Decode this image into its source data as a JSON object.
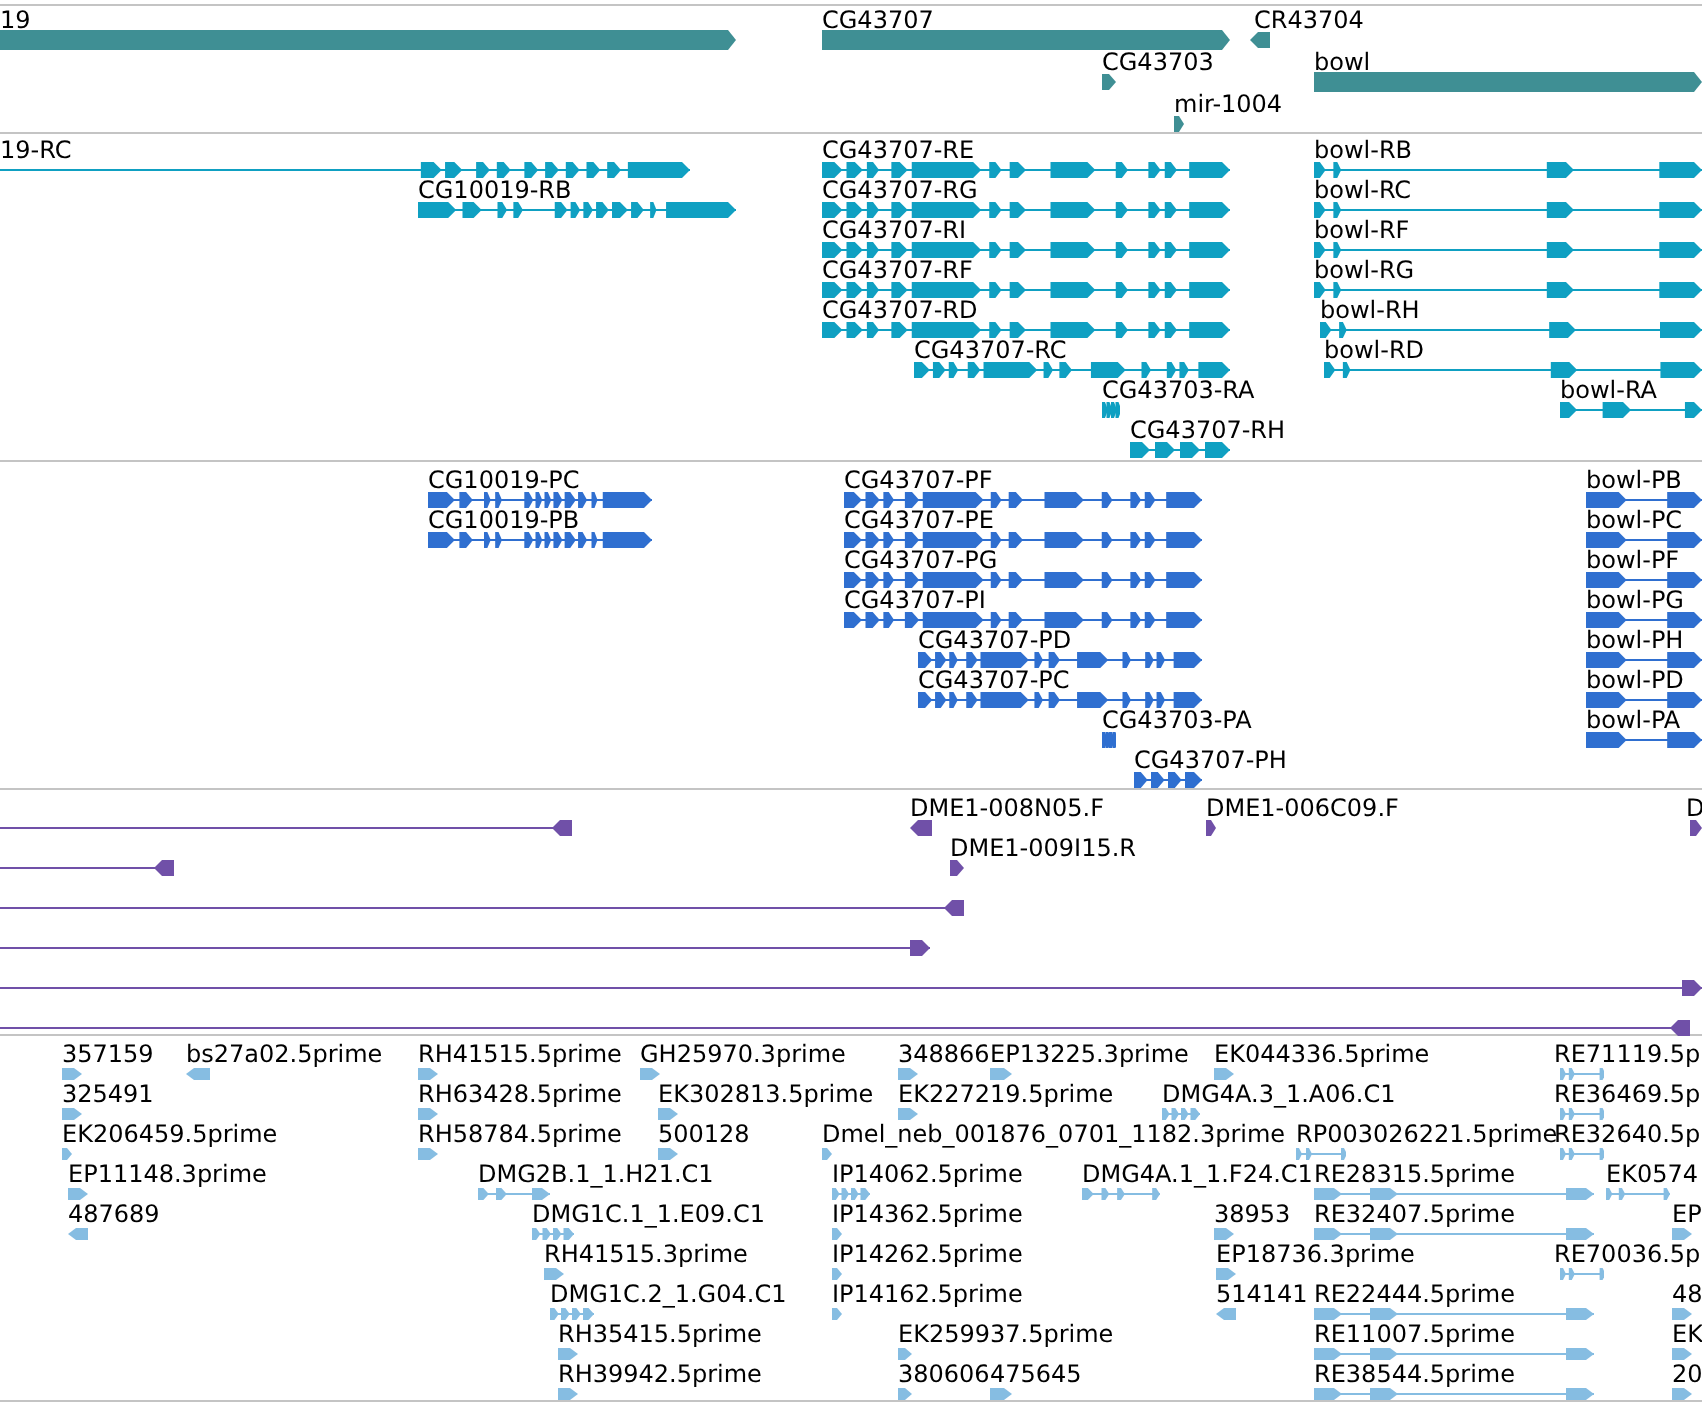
{
  "tracks": [
    {
      "kind": "genes",
      "features": [
        {
          "label": "19",
          "reverse": false
        },
        {
          "label": "CG43707",
          "reverse": false
        },
        {
          "label": "CR43704",
          "reverse": true
        },
        {
          "label": "CG43703",
          "reverse": false
        },
        {
          "label": "bowl",
          "reverse": false
        },
        {
          "label": "mir-1004",
          "reverse": false
        }
      ]
    },
    {
      "kind": "transcripts",
      "features": [
        {
          "label": "19-RC",
          "reverse": false
        },
        {
          "label": "CG10019-RB",
          "reverse": false
        },
        {
          "label": "CG43707-RE",
          "reverse": false
        },
        {
          "label": "CG43707-RG",
          "reverse": false
        },
        {
          "label": "CG43707-RI",
          "reverse": false
        },
        {
          "label": "CG43707-RF",
          "reverse": false
        },
        {
          "label": "CG43707-RD",
          "reverse": false
        },
        {
          "label": "CG43707-RC",
          "reverse": false
        },
        {
          "label": "CG43703-RA",
          "reverse": false
        },
        {
          "label": "CG43707-RH",
          "reverse": false
        },
        {
          "label": "bowl-RB",
          "reverse": false
        },
        {
          "label": "bowl-RC",
          "reverse": false
        },
        {
          "label": "bowl-RF",
          "reverse": false
        },
        {
          "label": "bowl-RG",
          "reverse": false
        },
        {
          "label": "bowl-RH",
          "reverse": false
        },
        {
          "label": "bowl-RD",
          "reverse": false
        },
        {
          "label": "bowl-RA",
          "reverse": false
        }
      ]
    },
    {
      "kind": "proteins",
      "features": [
        {
          "label": "CG10019-PC",
          "reverse": false
        },
        {
          "label": "CG10019-PB",
          "reverse": false
        },
        {
          "label": "CG43707-PF",
          "reverse": false
        },
        {
          "label": "CG43707-PE",
          "reverse": false
        },
        {
          "label": "CG43707-PG",
          "reverse": false
        },
        {
          "label": "CG43707-PI",
          "reverse": false
        },
        {
          "label": "CG43707-PD",
          "reverse": false
        },
        {
          "label": "CG43707-PC",
          "reverse": false
        },
        {
          "label": "CG43703-PA",
          "reverse": false
        },
        {
          "label": "CG43707-PH",
          "reverse": false
        },
        {
          "label": "bowl-PB",
          "reverse": false
        },
        {
          "label": "bowl-PC",
          "reverse": false
        },
        {
          "label": "bowl-PF",
          "reverse": false
        },
        {
          "label": "bowl-PG",
          "reverse": false
        },
        {
          "label": "bowl-PH",
          "reverse": false
        },
        {
          "label": "bowl-PD",
          "reverse": false
        },
        {
          "label": "bowl-PA",
          "reverse": false
        }
      ]
    },
    {
      "kind": "clones",
      "features": [
        {
          "reverse": true
        },
        {
          "label": "DME1-008N05.F",
          "reverse": true
        },
        {
          "label": "DME1-006C09.F",
          "reverse": false
        },
        {
          "label": "D",
          "reverse": false
        },
        {
          "reverse": true
        },
        {
          "label": "DME1-009I15.R",
          "reverse": false
        },
        {
          "reverse": true
        },
        {
          "reverse": false
        },
        {
          "reverse": false
        },
        {
          "reverse": true
        }
      ]
    },
    {
      "kind": "ests",
      "features": [
        {
          "label": "357159",
          "reverse": false
        },
        {
          "label": "bs27a02.5prime",
          "reverse": true
        },
        {
          "label": "RH41515.5prime",
          "reverse": false
        },
        {
          "label": "GH25970.3prime",
          "reverse": false
        },
        {
          "label": "348866",
          "reverse": false
        },
        {
          "label": "EP13225.3prime",
          "reverse": false
        },
        {
          "label": "EK044336.5prime",
          "reverse": false
        },
        {
          "label": "RE71119.5p",
          "reverse": false
        },
        {
          "label": "325491",
          "reverse": false
        },
        {
          "label": "RH63428.5prime",
          "reverse": false
        },
        {
          "label": "EK302813.5prime",
          "reverse": false
        },
        {
          "label": "EK227219.5prime",
          "reverse": false
        },
        {
          "label": "DMG4A.3_1.A06.C1",
          "reverse": false
        },
        {
          "label": "RE36469.5p",
          "reverse": false
        },
        {
          "label": "EK206459.5prime",
          "reverse": false
        },
        {
          "label": "RH58784.5prime",
          "reverse": false
        },
        {
          "label": "500128",
          "reverse": false
        },
        {
          "label": "Dmel_neb_001876_0701_1182.3prime",
          "reverse": false
        },
        {
          "label": "RP003026221.5prime",
          "reverse": false
        },
        {
          "label": "RE32640.5p",
          "reverse": false
        },
        {
          "label": "EP11148.3prime",
          "reverse": false
        },
        {
          "label": "DMG2B.1_1.H21.C1",
          "reverse": false
        },
        {
          "label": "IP14062.5prime",
          "reverse": false
        },
        {
          "label": "DMG4A.1_1.F24.C1",
          "reverse": false
        },
        {
          "label": "RE28315.5prime",
          "reverse": false
        },
        {
          "label": "EK0574",
          "reverse": false
        },
        {
          "label": "487689",
          "reverse": true
        },
        {
          "label": "DMG1C.1_1.E09.C1",
          "reverse": false
        },
        {
          "label": "IP14362.5prime",
          "reverse": false
        },
        {
          "label": "38953",
          "reverse": false
        },
        {
          "label": "RE32407.5prime",
          "reverse": false
        },
        {
          "label": "EP",
          "reverse": false
        },
        {
          "label": "RH41515.3prime",
          "reverse": false
        },
        {
          "label": "IP14262.5prime",
          "reverse": false
        },
        {
          "label": "EP18736.3prime",
          "reverse": false
        },
        {
          "label": "RE70036.5p",
          "reverse": false
        },
        {
          "label": "DMG1C.2_1.G04.C1",
          "reverse": false
        },
        {
          "label": "IP14162.5prime",
          "reverse": false
        },
        {
          "label": "514141",
          "reverse": true
        },
        {
          "label": "RE22444.5prime",
          "reverse": false
        },
        {
          "label": "48",
          "reverse": false
        },
        {
          "label": "RH35415.5prime",
          "reverse": false
        },
        {
          "label": "EK259937.5prime",
          "reverse": false
        },
        {
          "label": "RE11007.5prime",
          "reverse": false
        },
        {
          "label": "EK",
          "reverse": false
        },
        {
          "label": "RH39942.5prime",
          "reverse": false
        },
        {
          "label": "380606",
          "reverse": false
        },
        {
          "label": "475645",
          "reverse": false
        },
        {
          "label": "RE38544.5prime",
          "reverse": false
        },
        {
          "label": "20",
          "reverse": false
        }
      ]
    }
  ]
}
